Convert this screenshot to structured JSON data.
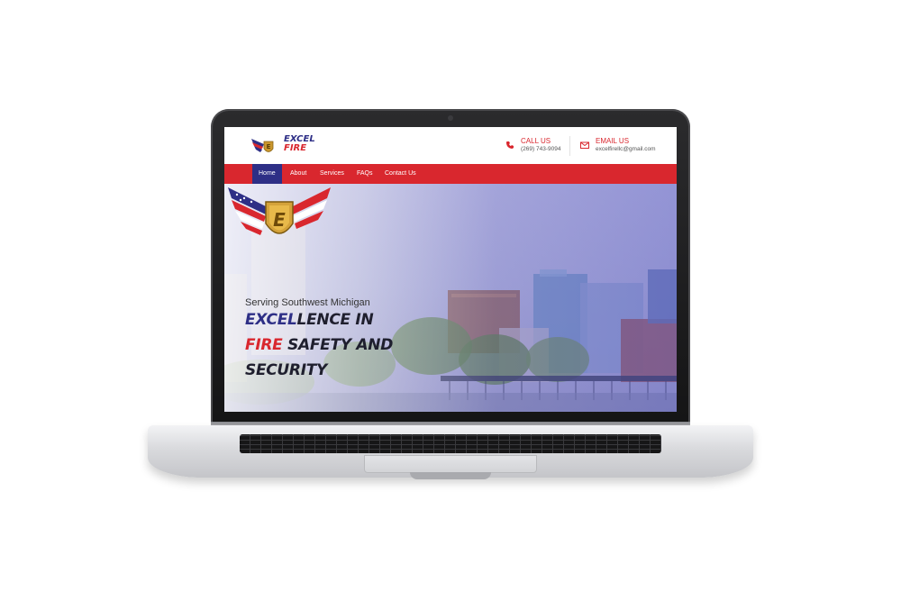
{
  "site": {
    "logo": {
      "line1": "EXCEL",
      "line2": "FIRE"
    },
    "contact": {
      "call": {
        "title": "CALL US",
        "value": "(269) 743-9094",
        "icon": "phone-icon"
      },
      "email": {
        "title": "EMAIL US",
        "value": "excelfirellc@gmail.com",
        "icon": "mail-icon"
      }
    },
    "nav": {
      "items": [
        {
          "label": "Home",
          "active": true
        },
        {
          "label": "About",
          "active": false
        },
        {
          "label": "Services",
          "active": false
        },
        {
          "label": "FAQs",
          "active": false
        },
        {
          "label": "Contact Us",
          "active": false
        }
      ]
    },
    "hero": {
      "tagline": "Serving Southwest Michigan",
      "headline": {
        "line1_accent": "EXCEL",
        "line1_rest": "LENCE IN",
        "line2_accent": "FIRE",
        "line2_rest": " SAFETY AND",
        "line3": "SECURITY"
      }
    }
  },
  "colors": {
    "brand_red": "#d9272e",
    "brand_blue": "#2e2f86"
  }
}
